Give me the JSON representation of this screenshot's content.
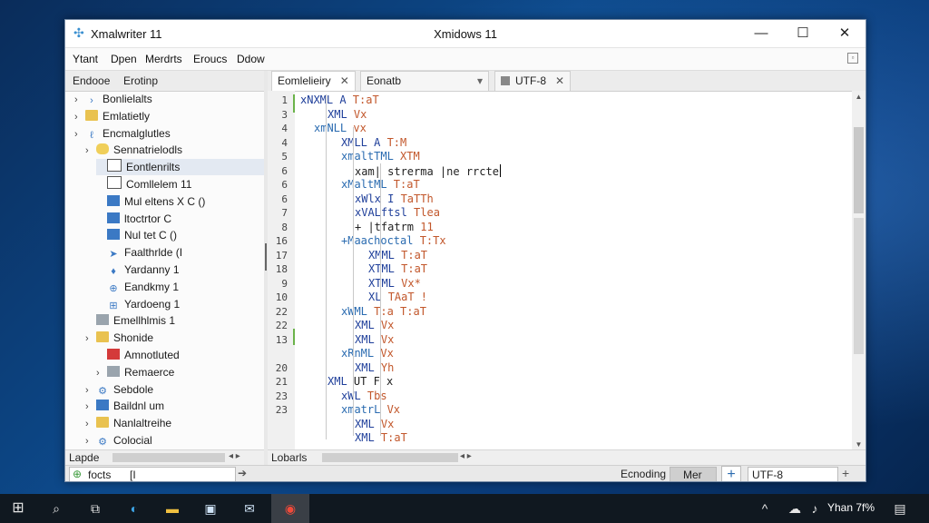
{
  "window": {
    "app_title": "Xmalwriter 11",
    "title": "Xmidows 11",
    "minimize_glyph": "—",
    "maximize_glyph": "☐",
    "close_glyph": "✕"
  },
  "menu": [
    "Ytant",
    "Dpen",
    "Merdrts",
    "Eroucs",
    "Ddow"
  ],
  "left_panel": {
    "tabs": [
      "Endooe",
      "Erotinp"
    ],
    "tree": [
      {
        "label": "Bonlielalts",
        "indent": 0,
        "icon": "chevron-icon",
        "chevron": "›"
      },
      {
        "label": "Emlatietly",
        "indent": 0,
        "icon": "folder-icon",
        "chevron": "›"
      },
      {
        "label": "Encmalglutles",
        "indent": 0,
        "icon": "link-icon",
        "chevron": "›"
      },
      {
        "label": "Sennatrielodls",
        "indent": 1,
        "icon": "database-icon",
        "chevron": "›"
      },
      {
        "label": "Eontlenrilts",
        "indent": 2,
        "icon": "document-icon",
        "chevron": ""
      },
      {
        "label": "Comllelem 11",
        "indent": 2,
        "icon": "document-icon",
        "chevron": ""
      },
      {
        "label": "Mul eltens X C ()",
        "indent": 2,
        "icon": "element-icon",
        "chevron": ""
      },
      {
        "label": "ltoctrtor  C",
        "indent": 2,
        "icon": "element-icon",
        "chevron": ""
      },
      {
        "label": "Nul tet C    ()",
        "indent": 2,
        "icon": "element-icon",
        "chevron": ""
      },
      {
        "label": "Faalthrlde (I",
        "indent": 2,
        "icon": "arrow-icon",
        "chevron": ""
      },
      {
        "label": "Yardanny 1",
        "indent": 2,
        "icon": "pin-icon",
        "chevron": ""
      },
      {
        "label": "Eandkmy 1",
        "indent": 2,
        "icon": "crosshair-icon",
        "chevron": ""
      },
      {
        "label": "Yardoeng 1",
        "indent": 2,
        "icon": "plus-icon",
        "chevron": ""
      },
      {
        "label": "Emellhlmis 1",
        "indent": 1,
        "icon": "folder-gray-icon",
        "chevron": ""
      },
      {
        "label": "Shonide",
        "indent": 1,
        "icon": "folder-icon",
        "chevron": "›"
      },
      {
        "label": "Amnotluted",
        "indent": 2,
        "icon": "error-icon",
        "chevron": ""
      },
      {
        "label": "Remaerce",
        "indent": 2,
        "icon": "gray-icon",
        "chevron": "›"
      },
      {
        "label": "Sebdole",
        "indent": 1,
        "icon": "gear-icon",
        "chevron": "›"
      },
      {
        "label": "Baildnl um",
        "indent": 1,
        "icon": "folder-blue-icon",
        "chevron": "›"
      },
      {
        "label": "Nanlaltreihe",
        "indent": 1,
        "icon": "folder-icon",
        "chevron": "›"
      },
      {
        "label": "Colocial",
        "indent": 1,
        "icon": "gear-icon",
        "chevron": "›"
      }
    ],
    "footer_label": "Lapde",
    "footer_arrows": "◂ ▸"
  },
  "editor": {
    "tabs": [
      {
        "label": "Eomlelieiry",
        "closable": true
      },
      {
        "label": "Eonatb",
        "closable": false
      },
      {
        "label": "UTF-8",
        "closable": true
      }
    ],
    "lines": [
      {
        "n": "1",
        "indent": 0,
        "parts": [
          [
            "tag",
            "xNXML A "
          ],
          [
            "attr",
            "T:aT"
          ]
        ]
      },
      {
        "n": "3",
        "indent": 2,
        "parts": [
          [
            "tag",
            "XML "
          ],
          [
            "attr",
            "Vx"
          ]
        ]
      },
      {
        "n": "4",
        "indent": 1,
        "parts": [
          [
            "tag2",
            "xmNLL "
          ],
          [
            "attr",
            "vx"
          ]
        ]
      },
      {
        "n": "4",
        "indent": 3,
        "parts": [
          [
            "tag",
            "XMLL A "
          ],
          [
            "attr",
            "T:M"
          ]
        ]
      },
      {
        "n": "5",
        "indent": 3,
        "parts": [
          [
            "tag2",
            "xmaltTML "
          ],
          [
            "attr",
            "XTM"
          ]
        ]
      },
      {
        "n": "6",
        "indent": 4,
        "parts": [
          [
            "txt",
            "xam| strerma |ne rrcte"
          ]
        ],
        "caret": true
      },
      {
        "n": "6",
        "indent": 3,
        "parts": [
          [
            "tag2",
            "xMaltML "
          ],
          [
            "attr",
            "T:aT"
          ]
        ]
      },
      {
        "n": "6",
        "indent": 4,
        "parts": [
          [
            "tag",
            "xWlx I "
          ],
          [
            "attr",
            "TaTTh"
          ]
        ]
      },
      {
        "n": "7",
        "indent": 4,
        "parts": [
          [
            "tag",
            "xVALftsl "
          ],
          [
            "attr",
            "Tlea"
          ]
        ]
      },
      {
        "n": "8",
        "indent": 4,
        "parts": [
          [
            "txt",
            "+ |tfatrm "
          ],
          [
            "attr",
            "11"
          ]
        ]
      },
      {
        "n": "16",
        "indent": 3,
        "parts": [
          [
            "tag2",
            "+Maachoctal "
          ],
          [
            "attr",
            "T:Tx"
          ]
        ]
      },
      {
        "n": "17",
        "indent": 5,
        "parts": [
          [
            "tag",
            "XMML "
          ],
          [
            "attr",
            "T:aT"
          ]
        ]
      },
      {
        "n": "18",
        "indent": 5,
        "parts": [
          [
            "tag",
            "XTML "
          ],
          [
            "attr",
            "T:aT"
          ]
        ]
      },
      {
        "n": "9",
        "indent": 5,
        "parts": [
          [
            "tag",
            "XTML "
          ],
          [
            "attr",
            "Vx*"
          ]
        ]
      },
      {
        "n": "10",
        "indent": 5,
        "parts": [
          [
            "tag",
            "XL "
          ],
          [
            "attr",
            "TAaT !"
          ]
        ]
      },
      {
        "n": "22",
        "indent": 3,
        "parts": [
          [
            "tag2",
            "xWML "
          ],
          [
            "attr",
            "T:a T:aT"
          ]
        ]
      },
      {
        "n": "22",
        "indent": 4,
        "parts": [
          [
            "tag",
            "XML "
          ],
          [
            "attr",
            "Vx"
          ]
        ]
      },
      {
        "n": "13",
        "indent": 4,
        "parts": [
          [
            "tag",
            "XML "
          ],
          [
            "attr",
            "Vx"
          ]
        ]
      },
      {
        "n": "",
        "indent": 3,
        "parts": [
          [
            "tag2",
            "xRnML "
          ],
          [
            "attr",
            "Vx"
          ]
        ]
      },
      {
        "n": "20",
        "indent": 4,
        "parts": [
          [
            "tag",
            "XML "
          ],
          [
            "attr",
            "Yh"
          ]
        ]
      },
      {
        "n": "21",
        "indent": 2,
        "parts": [
          [
            "tag",
            "XML "
          ],
          [
            "txt",
            "UT F x"
          ]
        ]
      },
      {
        "n": "23",
        "indent": 3,
        "parts": [
          [
            "tag",
            "xWL "
          ],
          [
            "attr",
            "Tbs"
          ]
        ]
      },
      {
        "n": "23",
        "indent": 3,
        "parts": [
          [
            "tag2",
            "xmatrL "
          ],
          [
            "attr",
            "Vx"
          ]
        ]
      },
      {
        "n": "",
        "indent": 4,
        "parts": [
          [
            "tag",
            "XML "
          ],
          [
            "attr",
            "Vx"
          ]
        ]
      },
      {
        "n": "",
        "indent": 4,
        "parts": [
          [
            "tag",
            "XML "
          ],
          [
            "attr",
            "T:aT"
          ]
        ]
      }
    ],
    "footer_label": "Lobarls",
    "footer_arrows": "◂ ▸"
  },
  "status": {
    "search_value": "focts",
    "search_extra": "[I",
    "encoding_label": "Ecnoding",
    "mode_label": "Mer",
    "encoding_value": "UTF-8"
  },
  "taskbar": {
    "tray_text": "Yhan 7f%"
  }
}
